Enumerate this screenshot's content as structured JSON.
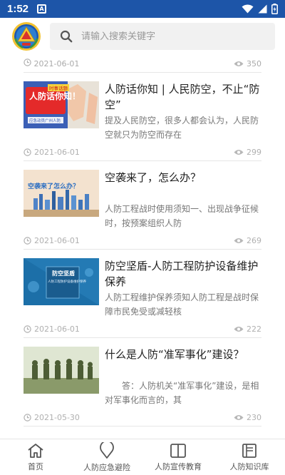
{
  "status_bar": {
    "time": "1:52",
    "app_icon_letter": "A"
  },
  "search": {
    "placeholder": "请输入搜索关键字"
  },
  "top_meta": {
    "date": "2021-06-01",
    "views": "350"
  },
  "articles": [
    {
      "title": "人防话你知 | 人民防空，不止“防空”",
      "summary": "提及人民防空，很多人都会认为，人民防空就只为防空而存在",
      "date": "2021-06-01",
      "views": "299",
      "thumb_text": "人防话你知！",
      "thumb_subtext": "应急动员广州人防",
      "thumb_tag": "时事话题"
    },
    {
      "title": "空袭来了，怎么办？",
      "summary": "人防工程战时使用须知一、出现战争征候时，按预案组织人防",
      "date": "2021-06-01",
      "views": "269",
      "thumb_text": "空袭来了怎么办？"
    },
    {
      "title": "防空坚盾-人防工程防护设备维护保养",
      "summary": "人防工程维护保养须知人防工程是战时保障市民免受或减轻核",
      "date": "2021-06-01",
      "views": "222",
      "thumb_text": "防空坚盾",
      "thumb_subtext": "人防工程防护设备维护保养"
    },
    {
      "title": "什么是人防“准军事化”建设？",
      "summary": "　　答：人防机关“准军事化”建设，是相对军事化而言的，其",
      "date": "2021-05-30",
      "views": "230"
    }
  ],
  "bottom_nav": [
    {
      "label": "首页",
      "icon": "home-icon"
    },
    {
      "label": "人防应急避险",
      "icon": "location-pin-icon"
    },
    {
      "label": "人防宣传教育",
      "icon": "book-icon"
    },
    {
      "label": "人防知识库",
      "icon": "library-icon"
    }
  ],
  "colors": {
    "status_bar": "#1d55a8",
    "nav_text": "#555555",
    "meta_text": "#b0b0b0"
  }
}
